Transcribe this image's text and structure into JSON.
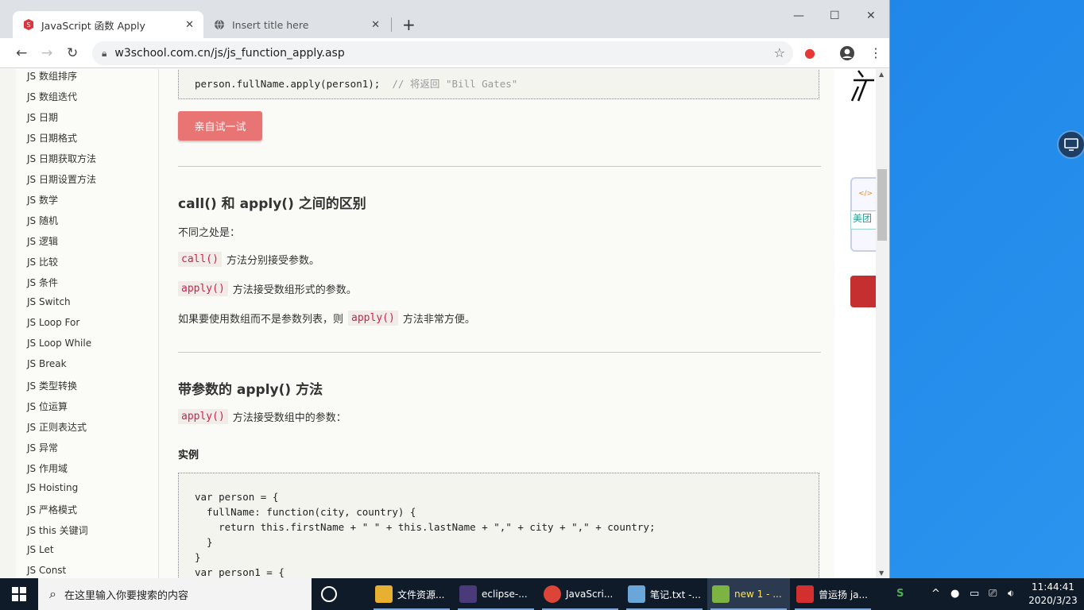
{
  "browser": {
    "tabs": [
      {
        "title": "JavaScript 函数 Apply",
        "active": true
      },
      {
        "title": "Insert title here",
        "active": false
      }
    ],
    "url": "w3school.com.cn/js/js_function_apply.asp",
    "close_glyph": "✕",
    "new_tab_glyph": "+"
  },
  "sidebar": {
    "items": [
      "JS 数组排序",
      "JS 数组迭代",
      "JS 日期",
      "JS 日期格式",
      "JS 日期获取方法",
      "JS 日期设置方法",
      "JS 数学",
      "JS 随机",
      "JS 逻辑",
      "JS 比较",
      "JS 条件",
      "JS Switch",
      "JS Loop For",
      "JS Loop While",
      "JS Break",
      "JS 类型转换",
      "JS 位运算",
      "JS 正则表达式",
      "JS 异常",
      "JS 作用域",
      "JS Hoisting",
      "JS 严格模式",
      "JS this 关键词",
      "JS Let",
      "JS Const"
    ]
  },
  "content": {
    "top_code_line": "person.fullName.apply(person1);",
    "top_code_comment": "// 将返回 \"Bill Gates\"",
    "try_button": "亲自试一试",
    "section1_title": "call() 和 apply() 之间的区别",
    "diff_intro": "不同之处是：",
    "call_code": "call()",
    "call_text": "方法分别接受参数。",
    "apply_code": "apply()",
    "apply_text": "方法接受数组形式的参数。",
    "array_text_before": "如果要使用数组而不是参数列表，则",
    "array_text_after": "方法非常方便。",
    "section2_title": "带参数的 apply() 方法",
    "apply_args_text": "方法接受数组中的参数：",
    "example_heading": "实例",
    "example_code": [
      "var person = {",
      "  fullName: function(city, country) {",
      "    return this.firstName + \" \" + this.lastName + \",\" + city + \",\" + country;",
      "  }",
      "}",
      "var person1 = {"
    ]
  },
  "ad": {
    "brand_text": "美团",
    "code_tag": "</>"
  },
  "taskbar": {
    "search_placeholder": "在这里输入你要搜索的内容",
    "items": [
      {
        "label": "文件资源...",
        "icon": "folder-icon",
        "color": "#e8b030"
      },
      {
        "label": "eclipse-...",
        "icon": "eclipse-icon",
        "color": "#4b3a7a"
      },
      {
        "label": "JavaScri...",
        "icon": "chrome-icon",
        "color": "#db4437"
      },
      {
        "label": "笔记.txt -...",
        "icon": "notepad-icon",
        "color": "#6aa6d8"
      },
      {
        "label": "new 1 - ...",
        "icon": "notepadpp-icon",
        "color": "#7cb342"
      },
      {
        "label": "曾运扬 ja...",
        "icon": "live-icon",
        "color": "#d32f2f"
      }
    ],
    "time": "11:44:41",
    "date": "2020/3/23"
  }
}
